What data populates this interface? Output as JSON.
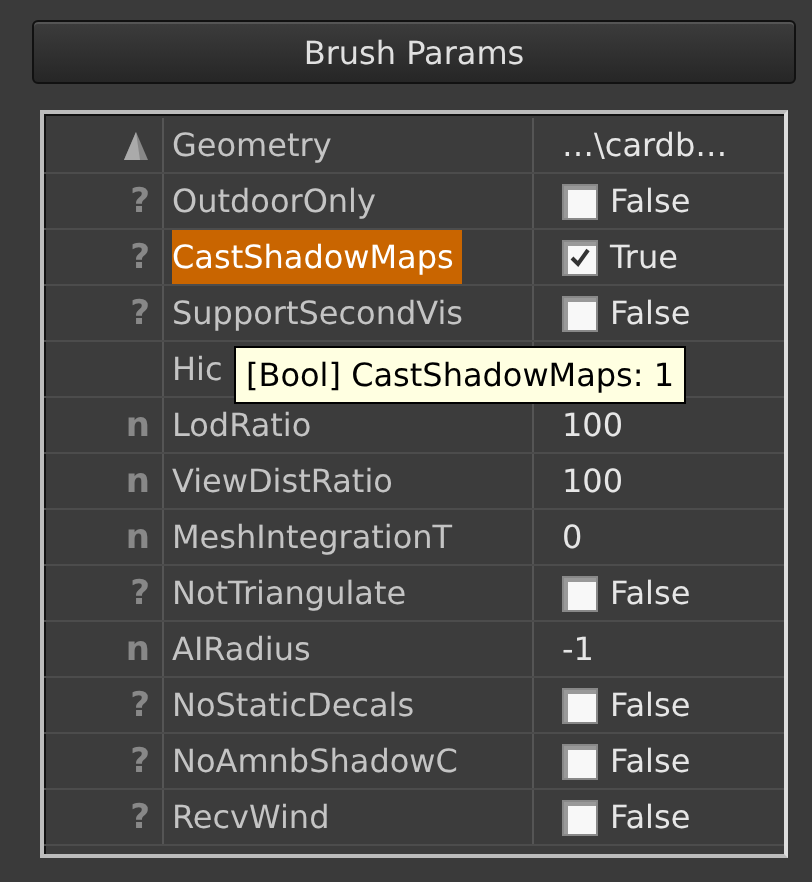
{
  "panel": {
    "title": "Brush Params"
  },
  "rows": [
    {
      "kind": "file",
      "name": "Geometry",
      "value": "…\\cardb…",
      "selected": false
    },
    {
      "kind": "bool",
      "marker": "?",
      "name": "OutdoorOnly",
      "checked": false,
      "value": "False",
      "selected": false
    },
    {
      "kind": "bool",
      "marker": "?",
      "name": "CastShadowMaps",
      "checked": true,
      "value": "True",
      "selected": true
    },
    {
      "kind": "bool",
      "marker": "?",
      "name": "SupportSecondVis",
      "checked": false,
      "value": "False",
      "selected": false
    },
    {
      "kind": "text",
      "name": "Hic",
      "selected": false
    },
    {
      "kind": "text",
      "marker": "n",
      "name": "LodRatio",
      "value": "100",
      "selected": false
    },
    {
      "kind": "text",
      "marker": "n",
      "name": "ViewDistRatio",
      "value": "100",
      "selected": false
    },
    {
      "kind": "text",
      "marker": "n",
      "name": "MeshIntegrationT",
      "value": "0",
      "selected": false
    },
    {
      "kind": "bool",
      "marker": "?",
      "name": "NotTriangulate",
      "checked": false,
      "value": "False",
      "selected": false
    },
    {
      "kind": "text",
      "marker": "n",
      "name": "AIRadius",
      "value": "-1",
      "selected": false
    },
    {
      "kind": "bool",
      "marker": "?",
      "name": "NoStaticDecals",
      "checked": false,
      "value": "False",
      "selected": false
    },
    {
      "kind": "bool",
      "marker": "?",
      "name": "NoAmnbShadowC",
      "checked": false,
      "value": "False",
      "selected": false
    },
    {
      "kind": "bool",
      "marker": "?",
      "name": "RecvWind",
      "checked": false,
      "value": "False",
      "selected": false
    }
  ],
  "tooltip": {
    "text": "[Bool] CastShadowMaps: 1"
  }
}
